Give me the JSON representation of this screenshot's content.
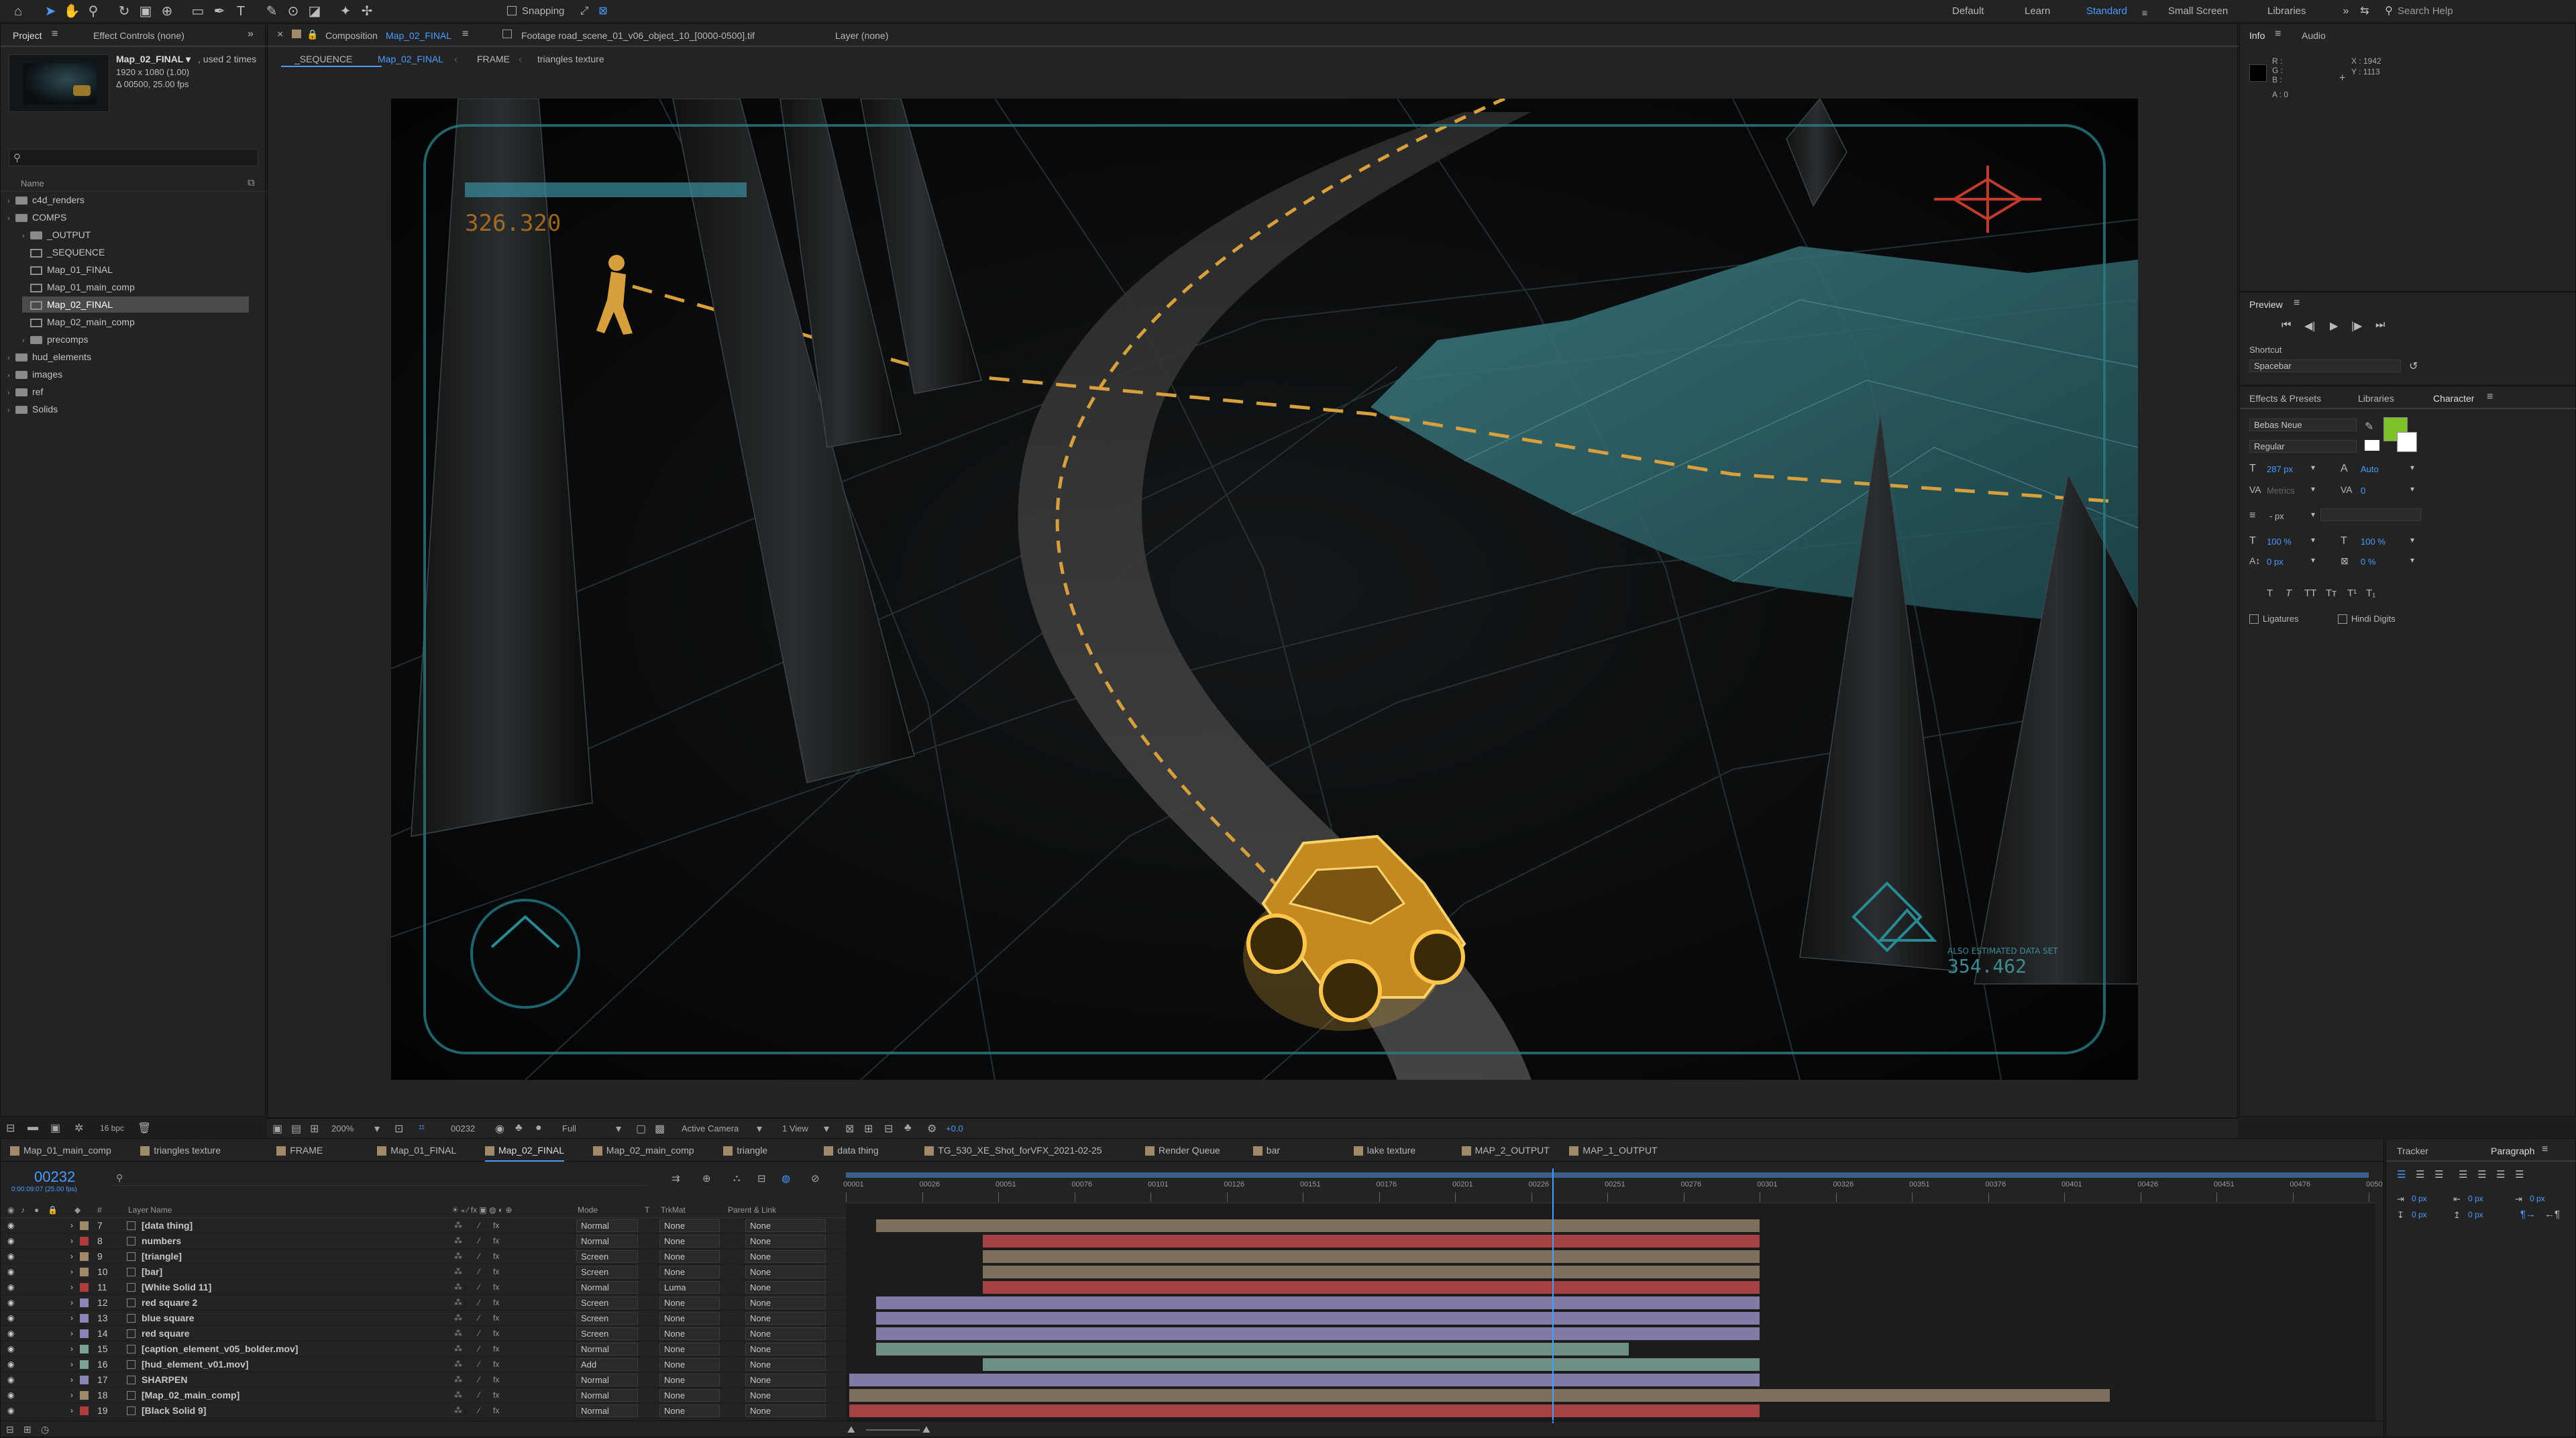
{
  "toolbar": {
    "snapping": "Snapping",
    "workspaces": [
      "Default",
      "Learn",
      "Standard",
      "Small Screen",
      "Libraries"
    ],
    "search_placeholder": "Search Help"
  },
  "project": {
    "tab": "Project",
    "effect_controls": "Effect Controls (none)",
    "item_name": "Map_02_FINAL ▾",
    "used": ", used 2 times",
    "res": "1920 x 1080 (1.00)",
    "dur": "Δ 00500, 25.00 fps",
    "col_name": "Name",
    "tree": [
      {
        "label": "c4d_renders",
        "type": "folder",
        "depth": 0
      },
      {
        "label": "COMPS",
        "type": "folder",
        "depth": 0
      },
      {
        "label": "_OUTPUT",
        "type": "folder",
        "depth": 1
      },
      {
        "label": "_SEQUENCE",
        "type": "comp",
        "depth": 1
      },
      {
        "label": "Map_01_FINAL",
        "type": "comp",
        "depth": 1
      },
      {
        "label": "Map_01_main_comp",
        "type": "comp",
        "depth": 1
      },
      {
        "label": "Map_02_FINAL",
        "type": "comp",
        "depth": 1,
        "selected": true
      },
      {
        "label": "Map_02_main_comp",
        "type": "comp",
        "depth": 1
      },
      {
        "label": "precomps",
        "type": "folder",
        "depth": 1
      },
      {
        "label": "hud_elements",
        "type": "folder",
        "depth": 0
      },
      {
        "label": "images",
        "type": "folder",
        "depth": 0
      },
      {
        "label": "ref",
        "type": "folder",
        "depth": 0
      },
      {
        "label": "Solids",
        "type": "folder",
        "depth": 0
      }
    ],
    "bpc": "16 bpc"
  },
  "viewer": {
    "tab_prefix": "Composition",
    "tab_comp": "Map_02_FINAL",
    "footage_tab": "Footage road_scene_01_v06_object_10_[0000-0500].tif",
    "layer_tab": "Layer (none)",
    "breadcrumbs": [
      "_SEQUENCE",
      "Map_02_FINAL",
      "FRAME",
      "triangles texture"
    ],
    "hud_readout_top": "326.320",
    "hud_readout_bottom": "354.462",
    "hud_small_text": "ALSO ESTIMATED DATA SET",
    "zoom": "200%",
    "timecode": "00232",
    "resolution": "Full",
    "camera": "Active Camera",
    "view": "1 View",
    "exposure": "+0.0"
  },
  "info": {
    "tab": "Info",
    "audio_tab": "Audio",
    "r": "R :",
    "g": "G :",
    "b": "B :",
    "a": "A : 0",
    "x": "X : 1942",
    "y": "Y : 1113"
  },
  "preview": {
    "tab": "Preview",
    "shortcut_label": "Shortcut",
    "shortcut_value": "Spacebar"
  },
  "character": {
    "tabs": [
      "Effects & Presets",
      "Libraries",
      "Character"
    ],
    "font": "Bebas Neue",
    "style": "Regular",
    "size": "287 px",
    "leading": "Auto",
    "kerning": "Metrics",
    "tracking": "0",
    "stroke": "- px",
    "vscale": "100 %",
    "hscale": "100 %",
    "baseline": "0 px",
    "tsume": "0 %",
    "ligatures": "Ligatures",
    "hindi": "Hindi Digits",
    "fill_color": "#7dc22b"
  },
  "timeline": {
    "tabs": [
      "Map_01_main_comp",
      "triangles texture",
      "FRAME",
      "Map_01_FINAL",
      "Map_02_FINAL",
      "Map_02_main_comp",
      "triangle",
      "data thing",
      "TG_530_XE_Shot_forVFX_2021-02-25",
      "Render Queue",
      "bar",
      "lake texture",
      "MAP_2_OUTPUT",
      "MAP_1_OUTPUT"
    ],
    "active_tab": "Map_02_FINAL",
    "timecode": "00232",
    "timecode_sub": "0:00:09:07 (25.00 fps)",
    "columns": {
      "layer_name": "Layer Name",
      "mode": "Mode",
      "t": "T",
      "trkmat": "TrkMat",
      "parent": "Parent & Link"
    },
    "ruler": [
      "00001",
      "00026",
      "00051",
      "00076",
      "00101",
      "00126",
      "00151",
      "00176",
      "00201",
      "00226",
      "00251",
      "00276",
      "00301",
      "00326",
      "00351",
      "00376",
      "00401",
      "00426",
      "00451",
      "00476",
      "0050"
    ],
    "current_frame": 232,
    "total_frames": 500,
    "layers": [
      {
        "num": "7",
        "name": "[data thing]",
        "mode": "Normal",
        "trk": "None",
        "parent": "None",
        "label": "#a08a6a",
        "start": 10,
        "end": 300,
        "bar": "#7d715d"
      },
      {
        "num": "8",
        "name": "numbers",
        "mode": "Normal",
        "trk": "None",
        "parent": "None",
        "label": "#b23b3b",
        "start": 45,
        "end": 300,
        "bar": "#a54344"
      },
      {
        "num": "9",
        "name": "[triangle]",
        "mode": "Screen",
        "trk": "None",
        "parent": "None",
        "label": "#a08a6a",
        "start": 45,
        "end": 300,
        "bar": "#7d715d"
      },
      {
        "num": "10",
        "name": "[bar]",
        "mode": "Screen",
        "trk": "None",
        "parent": "None",
        "label": "#a08a6a",
        "start": 45,
        "end": 300,
        "bar": "#7d715d"
      },
      {
        "num": "11",
        "name": "[White Solid 11]",
        "mode": "Normal",
        "trk": "Luma",
        "parent": "None",
        "label": "#b23b3b",
        "start": 45,
        "end": 300,
        "bar": "#a54344"
      },
      {
        "num": "12",
        "name": "red square 2",
        "mode": "Screen",
        "trk": "None",
        "parent": "None",
        "label": "#8a86b8",
        "start": 10,
        "end": 300,
        "bar": "#7f7ba6"
      },
      {
        "num": "13",
        "name": "blue square",
        "mode": "Screen",
        "trk": "None",
        "parent": "None",
        "label": "#8a86b8",
        "start": 10,
        "end": 300,
        "bar": "#7f7ba6"
      },
      {
        "num": "14",
        "name": "red square",
        "mode": "Screen",
        "trk": "None",
        "parent": "None",
        "label": "#8a86b8",
        "start": 10,
        "end": 300,
        "bar": "#7f7ba6"
      },
      {
        "num": "15",
        "name": "[caption_element_v05_bolder.mov]",
        "mode": "Normal",
        "trk": "None",
        "parent": "None",
        "label": "#7aa396",
        "start": 10,
        "end": 257,
        "bar": "#6e8f84"
      },
      {
        "num": "16",
        "name": "[hud_element_v01.mov]",
        "mode": "Add",
        "trk": "None",
        "parent": "None",
        "label": "#7aa396",
        "start": 45,
        "end": 300,
        "bar": "#6e8f84"
      },
      {
        "num": "17",
        "name": "SHARPEN",
        "mode": "Normal",
        "trk": "None",
        "parent": "None",
        "label": "#8a86b8",
        "start": 1,
        "end": 300,
        "bar": "#7f7ba6"
      },
      {
        "num": "18",
        "name": "[Map_02_main_comp]",
        "mode": "Normal",
        "trk": "None",
        "parent": "None",
        "label": "#a08a6a",
        "start": 1,
        "end": 415,
        "bar": "#7d715d"
      },
      {
        "num": "19",
        "name": "[Black Solid 9]",
        "mode": "Normal",
        "trk": "None",
        "parent": "None",
        "label": "#b23b3b",
        "start": 1,
        "end": 300,
        "bar": "#a54344"
      }
    ]
  },
  "right_bottom": {
    "tabs": [
      "Tracker",
      "Paragraph"
    ],
    "indent_left": "0 px",
    "indent_right": "0 px",
    "indent_first": "0 px",
    "space_before": "0 px",
    "space_after": "0 px"
  }
}
